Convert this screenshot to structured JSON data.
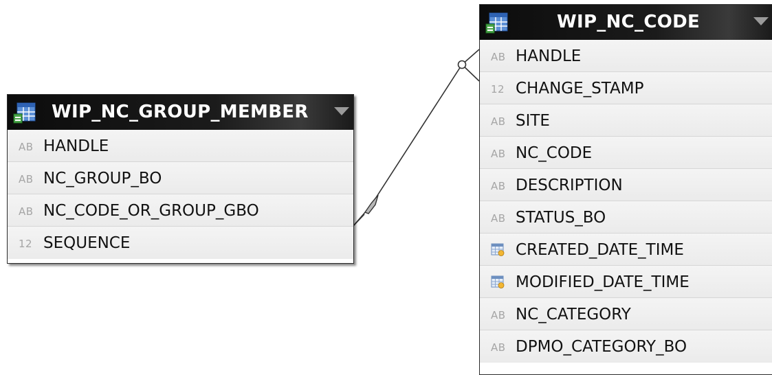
{
  "colors": {
    "header_bg": "#111111",
    "row_bg": "#efefef",
    "type_icon": "#a5a5a5",
    "line": "#333333"
  },
  "tables": {
    "member": {
      "title": "WIP_NC_GROUP_MEMBER",
      "icon": "table-icon",
      "columns": [
        {
          "type": "AB",
          "name": "HANDLE"
        },
        {
          "type": "AB",
          "name": "NC_GROUP_BO"
        },
        {
          "type": "AB",
          "name": "NC_CODE_OR_GROUP_GBO"
        },
        {
          "type": "12",
          "name": "SEQUENCE"
        }
      ]
    },
    "code": {
      "title": "WIP_NC_CODE",
      "icon": "table-icon",
      "columns": [
        {
          "type": "AB",
          "name": "HANDLE"
        },
        {
          "type": "12",
          "name": "CHANGE_STAMP"
        },
        {
          "type": "AB",
          "name": "SITE"
        },
        {
          "type": "AB",
          "name": "NC_CODE"
        },
        {
          "type": "AB",
          "name": "DESCRIPTION"
        },
        {
          "type": "AB",
          "name": "STATUS_BO"
        },
        {
          "type": "date-icon",
          "name": "CREATED_DATE_TIME"
        },
        {
          "type": "date-icon",
          "name": "MODIFIED_DATE_TIME"
        },
        {
          "type": "AB",
          "name": "NC_CATEGORY"
        },
        {
          "type": "AB",
          "name": "DPMO_CATEGORY_BO"
        }
      ]
    }
  },
  "relationship": {
    "from": "WIP_NC_GROUP_MEMBER.NC_CODE_OR_GROUP_GBO",
    "to": "WIP_NC_CODE.HANDLE",
    "from_end": "diamond",
    "to_end": "circle"
  }
}
